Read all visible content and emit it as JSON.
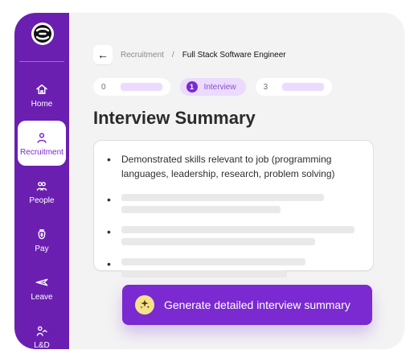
{
  "sidebar": {
    "items": [
      {
        "label": "Home",
        "icon": "home-icon"
      },
      {
        "label": "Recruitment",
        "icon": "user-icon",
        "active": true
      },
      {
        "label": "People",
        "icon": "people-icon"
      },
      {
        "label": "Pay",
        "icon": "money-bag-icon"
      },
      {
        "label": "Leave",
        "icon": "plane-icon"
      },
      {
        "label": "L&D",
        "icon": "learning-icon"
      }
    ]
  },
  "header": {
    "breadcrumb": {
      "parent": "Recruitment",
      "separator": "/",
      "current": "Full Stack Software Engineer"
    },
    "back_icon": "←"
  },
  "steps": {
    "left_number": "0",
    "active_number": "1",
    "active_label": "Interview",
    "right_number": "3"
  },
  "page": {
    "title": "Interview Summary"
  },
  "summary": {
    "first_bullet": "Demonstrated skills relevant to job (programming languages, leadership, research, problem solving)",
    "bullet_symbol": "•"
  },
  "cta": {
    "label": "Generate detailed interview summary",
    "icon": "sparkles-icon"
  },
  "colors": {
    "sidebar": "#6b1fb0",
    "accent": "#7a2ad0",
    "lavender": "#eadbff",
    "skeleton": "#e9e9e9"
  }
}
